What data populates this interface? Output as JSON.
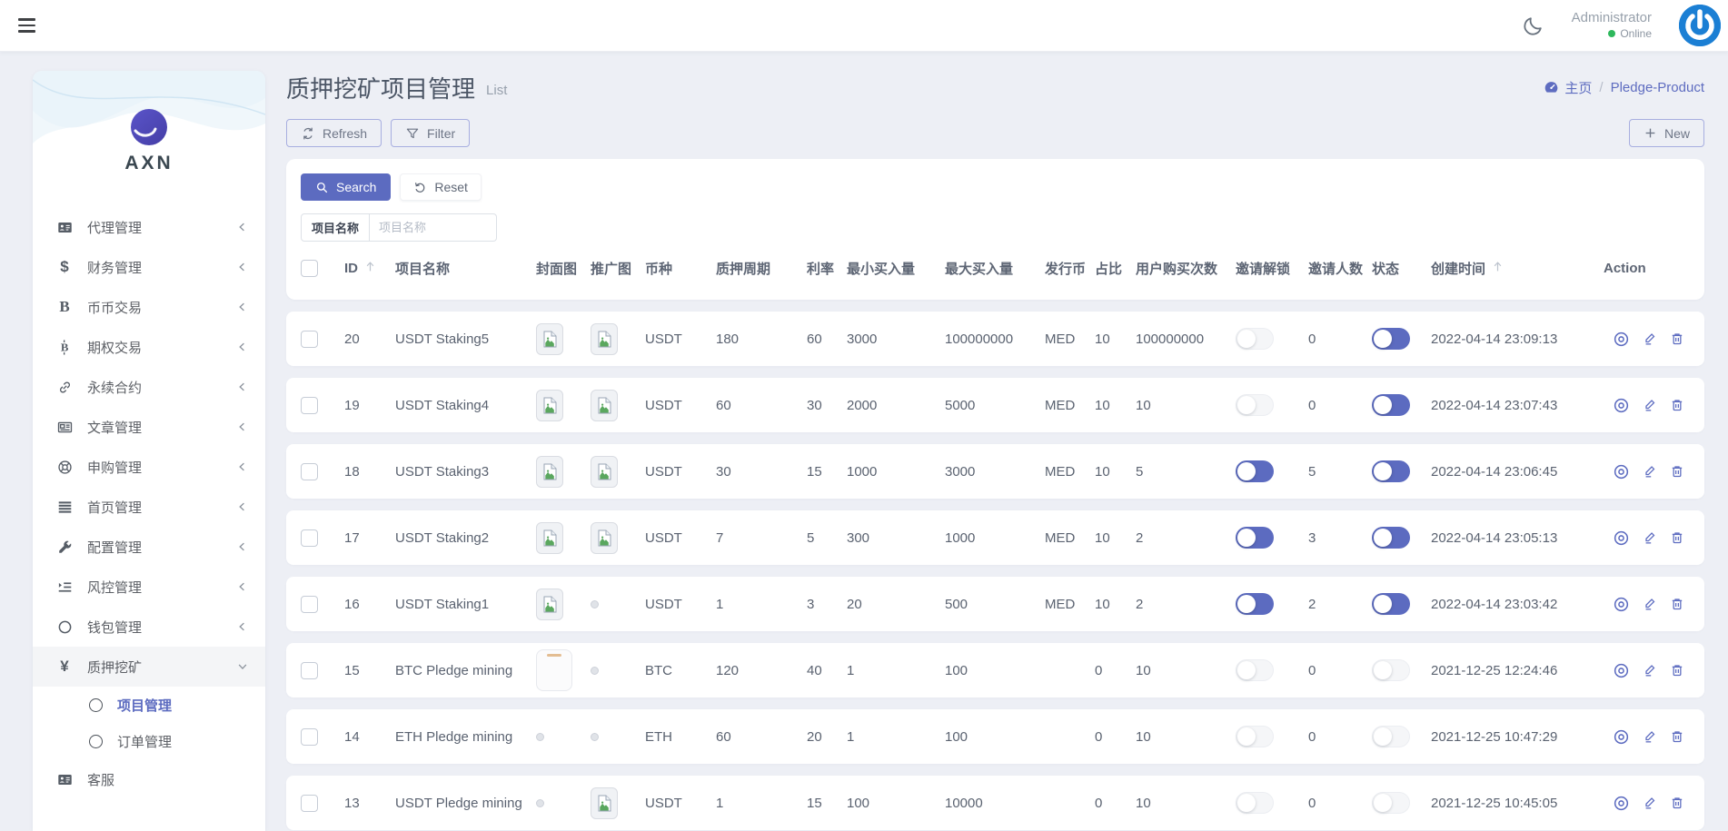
{
  "navbar": {
    "user_name": "Administrator",
    "user_status": "Online"
  },
  "sidebar": {
    "logo_text": "AXN",
    "items": [
      {
        "label": "代理管理",
        "icon": "id-card",
        "chevron": "left"
      },
      {
        "label": "财务管理",
        "icon": "dollar",
        "chevron": "left"
      },
      {
        "label": "币币交易",
        "icon": "letter-b",
        "chevron": "left"
      },
      {
        "label": "期权交易",
        "icon": "bitcoin",
        "chevron": "left"
      },
      {
        "label": "永续合约",
        "icon": "link",
        "chevron": "left"
      },
      {
        "label": "文章管理",
        "icon": "newspaper",
        "chevron": "left"
      },
      {
        "label": "申购管理",
        "icon": "life-ring",
        "chevron": "left"
      },
      {
        "label": "首页管理",
        "icon": "list",
        "chevron": "left"
      },
      {
        "label": "配置管理",
        "icon": "wrench",
        "chevron": "left"
      },
      {
        "label": "风控管理",
        "icon": "indent",
        "chevron": "left"
      },
      {
        "label": "钱包管理",
        "icon": "circle",
        "chevron": "left"
      },
      {
        "label": "质押挖矿",
        "icon": "yen",
        "chevron": "down",
        "active": true,
        "children": [
          {
            "label": "项目管理",
            "active": true
          },
          {
            "label": "订单管理",
            "active": false
          }
        ]
      },
      {
        "label": "客服",
        "icon": "id-card",
        "chevron": ""
      }
    ]
  },
  "page": {
    "title": "质押挖矿项目管理",
    "subtitle": "List",
    "breadcrumb_home": "主页",
    "breadcrumb_current": "Pledge-Product"
  },
  "toolbar": {
    "refresh_label": "Refresh",
    "filter_label": "Filter",
    "new_label": "New"
  },
  "filters": {
    "search_label": "Search",
    "reset_label": "Reset",
    "name_label": "项目名称",
    "name_placeholder": "项目名称"
  },
  "table": {
    "headers": [
      "ID",
      "项目名称",
      "封面图",
      "推广图",
      "币种",
      "质押周期",
      "利率",
      "最小买入量",
      "最大买入量",
      "发行币",
      "占比",
      "用户购买次数",
      "邀请解锁",
      "邀请人数",
      "状态",
      "创建时间",
      "Action"
    ],
    "sorted_columns": [
      "ID",
      "创建时间"
    ],
    "rows": [
      {
        "id": 20,
        "name": "USDT Staking5",
        "cover": "broken",
        "promo": "broken",
        "coin": "USDT",
        "period": 180,
        "rate": 60,
        "min_buy": 3000,
        "max_buy": 100000000,
        "issuer": "MED",
        "ratio": 10,
        "buy_count": 100000000,
        "invite_unlock": false,
        "invite_count": 0,
        "status": true,
        "created_at": "2022-04-14 23:09:13"
      },
      {
        "id": 19,
        "name": "USDT Staking4",
        "cover": "broken",
        "promo": "broken",
        "coin": "USDT",
        "period": 60,
        "rate": 30,
        "min_buy": 2000,
        "max_buy": 5000,
        "issuer": "MED",
        "ratio": 10,
        "buy_count": 10,
        "invite_unlock": false,
        "invite_count": 0,
        "status": true,
        "created_at": "2022-04-14 23:07:43"
      },
      {
        "id": 18,
        "name": "USDT Staking3",
        "cover": "broken",
        "promo": "broken",
        "coin": "USDT",
        "period": 30,
        "rate": 15,
        "min_buy": 1000,
        "max_buy": 3000,
        "issuer": "MED",
        "ratio": 10,
        "buy_count": 5,
        "invite_unlock": true,
        "invite_count": 5,
        "status": true,
        "created_at": "2022-04-14 23:06:45"
      },
      {
        "id": 17,
        "name": "USDT Staking2",
        "cover": "broken",
        "promo": "broken",
        "coin": "USDT",
        "period": 7,
        "rate": 5,
        "min_buy": 300,
        "max_buy": 1000,
        "issuer": "MED",
        "ratio": 10,
        "buy_count": 2,
        "invite_unlock": true,
        "invite_count": 3,
        "status": true,
        "created_at": "2022-04-14 23:05:13"
      },
      {
        "id": 16,
        "name": "USDT Staking1",
        "cover": "broken",
        "promo": "dot",
        "coin": "USDT",
        "period": 1,
        "rate": 3,
        "min_buy": 20,
        "max_buy": 500,
        "issuer": "MED",
        "ratio": 10,
        "buy_count": 2,
        "invite_unlock": true,
        "invite_count": 2,
        "status": true,
        "created_at": "2022-04-14 23:03:42"
      },
      {
        "id": 15,
        "name": "BTC Pledge mining",
        "cover": "blank",
        "promo": "dot",
        "coin": "BTC",
        "period": 120,
        "rate": 40,
        "min_buy": 1,
        "max_buy": 100,
        "issuer": "",
        "ratio": 0,
        "buy_count": 10,
        "invite_unlock": false,
        "invite_count": 0,
        "status": false,
        "created_at": "2021-12-25 12:24:46"
      },
      {
        "id": 14,
        "name": "ETH Pledge mining",
        "cover": "dot",
        "promo": "dot",
        "coin": "ETH",
        "period": 60,
        "rate": 20,
        "min_buy": 1,
        "max_buy": 100,
        "issuer": "",
        "ratio": 0,
        "buy_count": 10,
        "invite_unlock": false,
        "invite_count": 0,
        "status": false,
        "created_at": "2021-12-25 10:47:29"
      },
      {
        "id": 13,
        "name": "USDT Pledge mining",
        "cover": "dot",
        "promo": "broken",
        "coin": "USDT",
        "period": 1,
        "rate": 15,
        "min_buy": 100,
        "max_buy": 10000,
        "issuer": "",
        "ratio": 0,
        "buy_count": 10,
        "invite_unlock": false,
        "invite_count": 0,
        "status": false,
        "created_at": "2021-12-25 10:45:05"
      }
    ]
  }
}
